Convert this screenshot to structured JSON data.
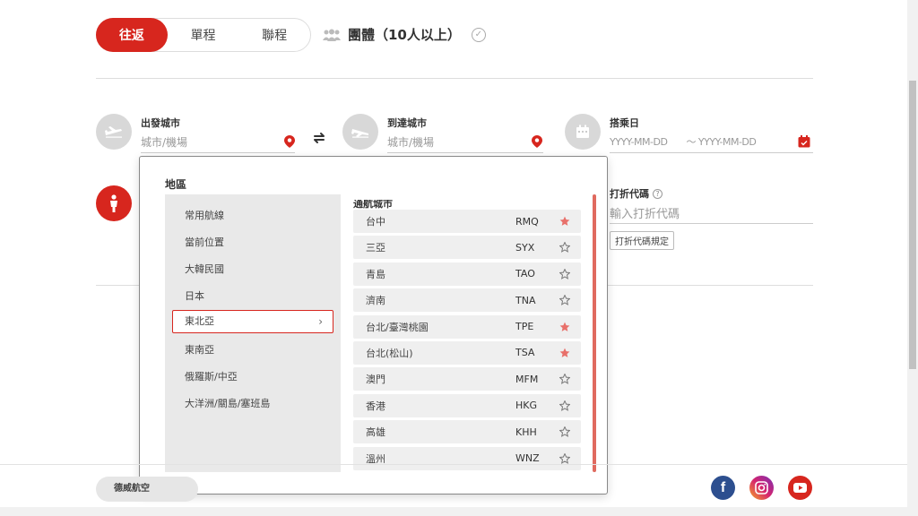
{
  "trip_types": [
    {
      "label": "往返",
      "active": true
    },
    {
      "label": "單程",
      "active": false
    },
    {
      "label": "聯程",
      "active": false
    }
  ],
  "group_option": {
    "label": "團體（10人以上）"
  },
  "departure": {
    "label": "出發城市",
    "placeholder": "城市/機場"
  },
  "arrival": {
    "label": "到達城市",
    "placeholder": "城市/機場"
  },
  "date": {
    "label": "搭乘日",
    "from_placeholder": "YYYY-MM-DD",
    "to_placeholder": "～ YYYY-MM-DD"
  },
  "promo": {
    "label": "打折代碼",
    "help": "?",
    "placeholder": "輸入打折代碼",
    "rules_button": "打折代碼規定"
  },
  "dropdown": {
    "region_title": "地區",
    "cities_title": "通航城市",
    "regions": [
      {
        "label": "常用航線"
      },
      {
        "label": "當前位置"
      },
      {
        "label": "大韓民國"
      },
      {
        "label": "日本"
      },
      {
        "label": "東北亞",
        "selected": true
      },
      {
        "label": "東南亞"
      },
      {
        "label": "俄羅斯/中亞"
      },
      {
        "label": "大洋洲/關島/塞班島"
      }
    ],
    "cities": [
      {
        "name": "台中",
        "code": "RMQ",
        "favorite": true
      },
      {
        "name": "三亞",
        "code": "SYX",
        "favorite": false
      },
      {
        "name": "青島",
        "code": "TAO",
        "favorite": false
      },
      {
        "name": "濟南",
        "code": "TNA",
        "favorite": false
      },
      {
        "name": "台北/臺灣桃園",
        "code": "TPE",
        "favorite": true
      },
      {
        "name": "台北(松山)",
        "code": "TSA",
        "favorite": true
      },
      {
        "name": "澳門",
        "code": "MFM",
        "favorite": false
      },
      {
        "name": "香港",
        "code": "HKG",
        "favorite": false
      },
      {
        "name": "高雄",
        "code": "KHH",
        "favorite": false
      },
      {
        "name": "溫州",
        "code": "WNZ",
        "favorite": false
      }
    ]
  },
  "footer": {
    "pill_label": "德威航空"
  },
  "social": {
    "facebook": "f"
  },
  "colors": {
    "accent": "#d7261e",
    "star_fav": "#e8706a",
    "star_empty": "#777777"
  }
}
